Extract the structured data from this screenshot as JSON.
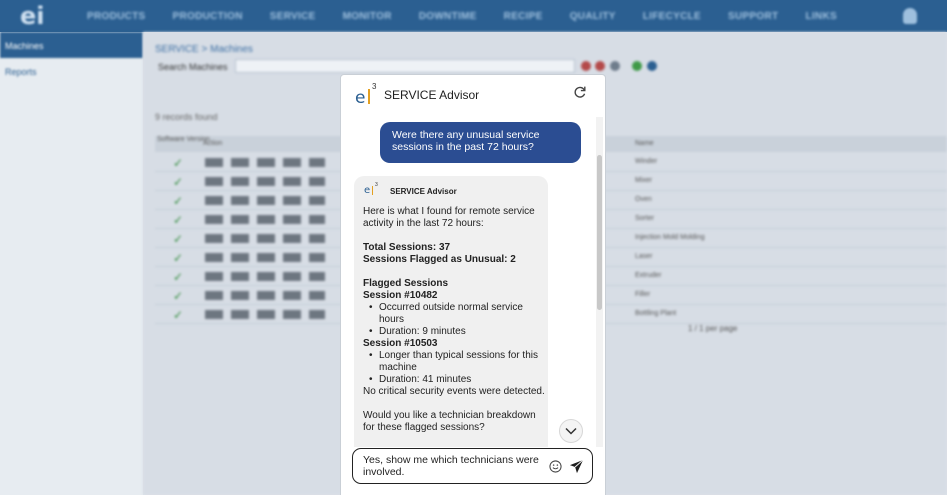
{
  "background": {
    "logo": "ei",
    "nav": [
      "PRODUCTS",
      "PRODUCTION",
      "SERVICE",
      "MONITOR",
      "DOWNTIME",
      "RECIPE",
      "QUALITY",
      "LIFECYCLE",
      "SUPPORT",
      "LINKS"
    ],
    "sidebar": [
      "Machines",
      "Reports"
    ],
    "breadcrumb": "SERVICE > Machines",
    "search_label": "Search Machines",
    "count_text": "9 records found",
    "columns": [
      "Software Version",
      "Action",
      "Name"
    ],
    "names": [
      "Winder",
      "Mixer",
      "Oven",
      "Sorter",
      "Injection Mold Molding",
      "Laser",
      "Extruder",
      "Filler",
      "Bottling Plant"
    ],
    "pager": "1 / 1    per page"
  },
  "chat": {
    "title": "SERVICE Advisor",
    "logo_letter": "e",
    "logo_sup": "3",
    "user_message": "Were there any unusual service sessions in the past 72 hours?",
    "bot_name": "SERVICE Advisor",
    "intro": "Here is what I found for remote service activity in the last 72 hours:",
    "total_sessions": "Total Sessions: 37",
    "flagged_count": "Sessions Flagged as Unusual: 2",
    "flagged_heading": "Flagged Sessions",
    "sessions": [
      {
        "title": "Session #10482",
        "bullets": [
          "Occurred outside normal service hours",
          "Duration: 9 minutes"
        ]
      },
      {
        "title": "Session #10503",
        "bullets": [
          "Longer than typical sessions for this machine",
          "Duration: 41 minutes"
        ]
      }
    ],
    "no_critical": "No critical security events were detected.",
    "question": "Would you like a technician breakdown for these flagged sessions?",
    "input_value": "Yes, show me which technicians were involved.",
    "icons": {
      "refresh": "refresh-icon",
      "scroll": "chevron-down-icon",
      "emoji": "smiley-icon",
      "send": "send-icon"
    },
    "colors": {
      "user_bubble": "#2b4d92",
      "bot_bubble": "#f0f0f0",
      "brand_accent": "#e3a021"
    }
  }
}
